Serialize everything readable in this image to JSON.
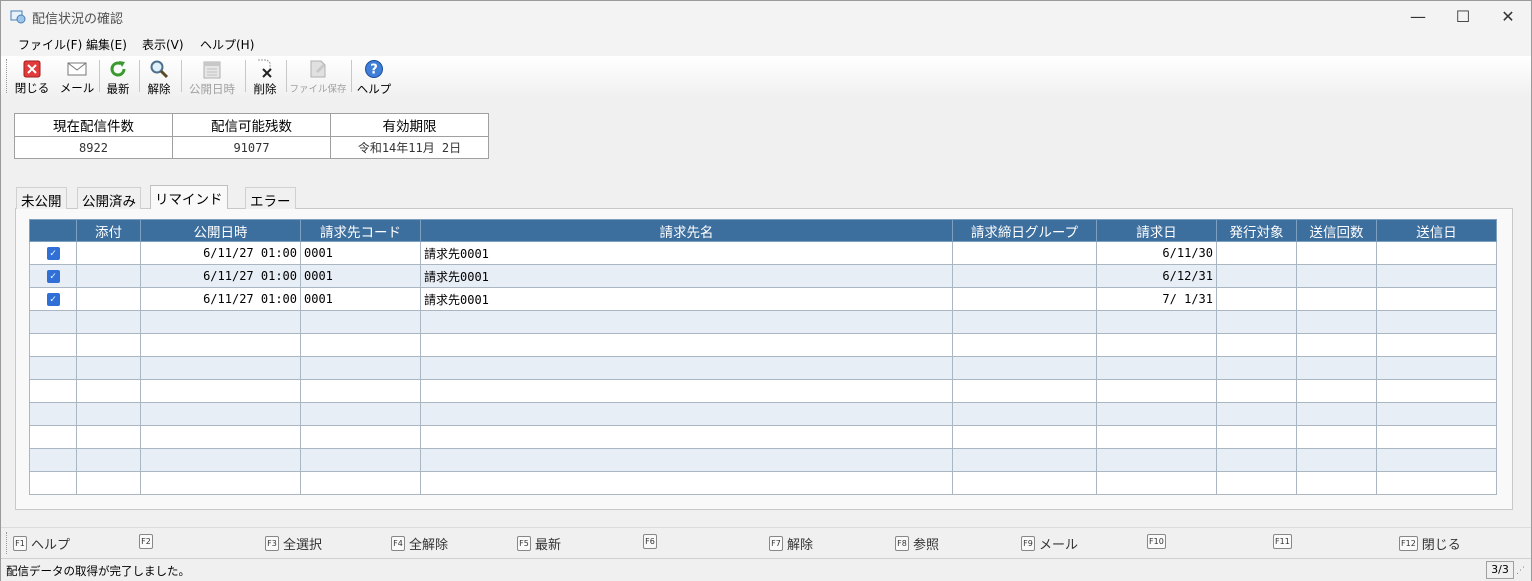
{
  "window": {
    "title": "配信状況の確認"
  },
  "menu": [
    "ファイル(F)",
    "編集(E)",
    "表示(V)",
    "ヘルプ(H)"
  ],
  "toolbar": {
    "close": "閉じる",
    "mail": "メール",
    "refresh": "最新",
    "release": "解除",
    "publish_datetime": "公開日時",
    "delete": "削除",
    "file_save": "ファイル保存",
    "help": "ヘルプ"
  },
  "summary": {
    "headers": [
      "現在配信件数",
      "配信可能残数",
      "有効期限"
    ],
    "values": [
      "8922",
      "91077",
      "令和14年11月 2日"
    ]
  },
  "tabs": [
    "未公開",
    "公開済み",
    "リマインド",
    "エラー"
  ],
  "grid": {
    "headers": [
      "",
      "添付",
      "公開日時",
      "請求先コード",
      "請求先名",
      "請求締日グループ",
      "請求日",
      "発行対象",
      "送信回数",
      "送信日"
    ],
    "rows": [
      {
        "checked": true,
        "attach": "",
        "publish": "6/11/27 01:00",
        "code": "0001",
        "name": "請求先0001",
        "group": "",
        "date": "6/11/30",
        "target": "",
        "count": "",
        "sent": ""
      },
      {
        "checked": true,
        "attach": "",
        "publish": "6/11/27 01:00",
        "code": "0001",
        "name": "請求先0001",
        "group": "",
        "date": "6/12/31",
        "target": "",
        "count": "",
        "sent": ""
      },
      {
        "checked": true,
        "attach": "",
        "publish": "6/11/27 01:00",
        "code": "0001",
        "name": "請求先0001",
        "group": "",
        "date": "7/ 1/31",
        "target": "",
        "count": "",
        "sent": ""
      }
    ],
    "empty_rows": 8
  },
  "fkeys": [
    {
      "key": "F1",
      "label": "ヘルプ"
    },
    {
      "key": "F2",
      "label": ""
    },
    {
      "key": "F3",
      "label": "全選択"
    },
    {
      "key": "F4",
      "label": "全解除"
    },
    {
      "key": "F5",
      "label": "最新"
    },
    {
      "key": "F6",
      "label": ""
    },
    {
      "key": "F7",
      "label": "解除"
    },
    {
      "key": "F8",
      "label": "参照"
    },
    {
      "key": "F9",
      "label": "メール"
    },
    {
      "key": "F10",
      "label": ""
    },
    {
      "key": "F11",
      "label": ""
    },
    {
      "key": "F12",
      "label": "閉じる"
    }
  ],
  "status": {
    "message": "配信データの取得が完了しました。",
    "count": "3/3"
  },
  "colors": {
    "grid_header": "#3c6e9e",
    "row_alt": "#e8eef5",
    "checkbox": "#2f6fd6"
  }
}
